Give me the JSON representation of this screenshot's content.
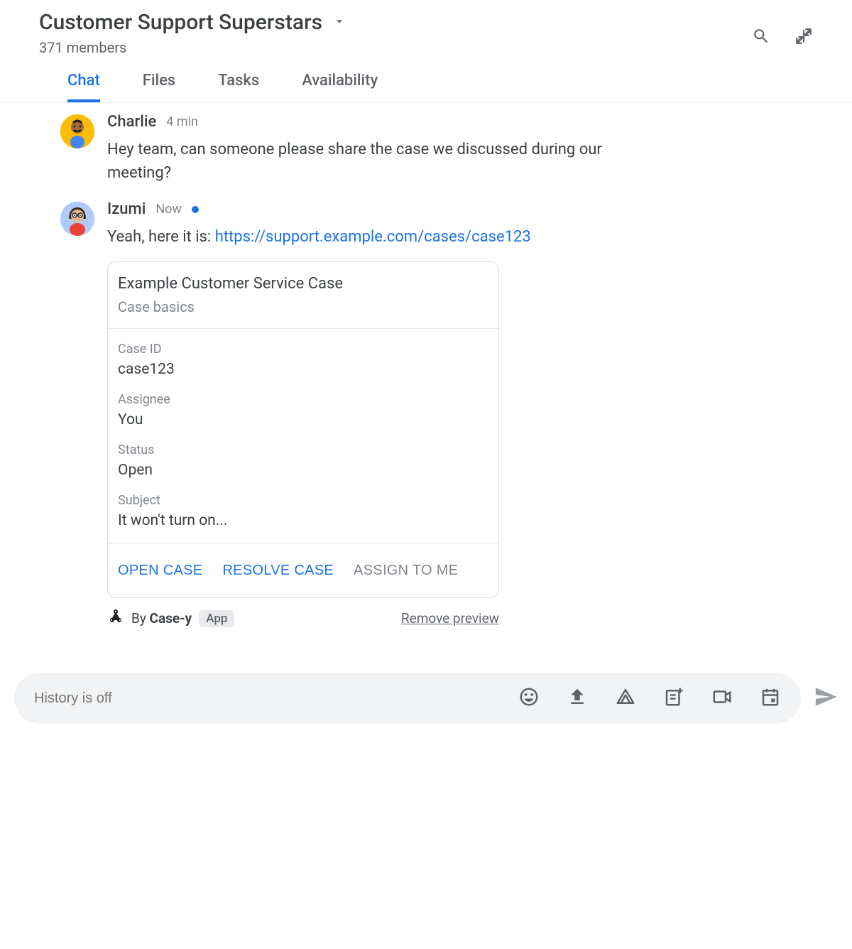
{
  "header": {
    "title": "Customer Support Superstars",
    "members": "371 members"
  },
  "tabs": [
    {
      "label": "Chat",
      "active": true
    },
    {
      "label": "Files",
      "active": false
    },
    {
      "label": "Tasks",
      "active": false
    },
    {
      "label": "Availability",
      "active": false
    }
  ],
  "messages": [
    {
      "author": "Charlie",
      "time": "4 min",
      "text": "Hey team, can someone please share the case we discussed during our meeting?",
      "showDot": false
    },
    {
      "author": "Izumi",
      "time": "Now",
      "text_prefix": "Yeah, here it is: ",
      "link": "https://support.example.com/cases/case123",
      "showDot": true
    }
  ],
  "card": {
    "title": "Example Customer Service Case",
    "subtitle": "Case basics",
    "fields": [
      {
        "label": "Case ID",
        "value": "case123"
      },
      {
        "label": "Assignee",
        "value": "You"
      },
      {
        "label": "Status",
        "value": "Open"
      },
      {
        "label": "Subject",
        "value": "It won't turn on..."
      }
    ],
    "actions": {
      "open": "OPEN CASE",
      "resolve": "RESOLVE CASE",
      "assign": "ASSIGN TO ME"
    },
    "by_prefix": "By ",
    "by_name": "Case-y",
    "app_badge": "App",
    "remove": "Remove preview"
  },
  "composer": {
    "placeholder": "History is off"
  }
}
